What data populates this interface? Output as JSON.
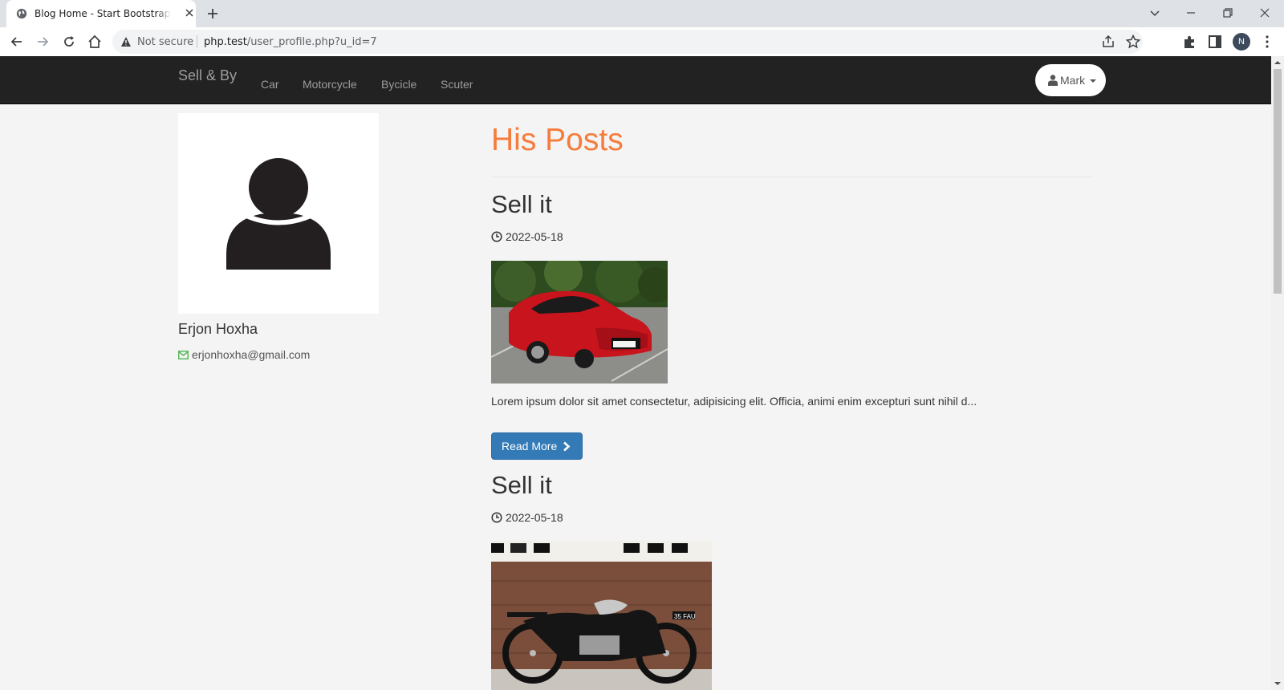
{
  "browser": {
    "tab_title": "Blog Home - Start Bootstrap Template",
    "security_label": "Not secure",
    "url_host": "php.test",
    "url_path": "/user_profile.php?u_id=7",
    "profile_initial": "N"
  },
  "navbar": {
    "brand": "Sell & By",
    "links": [
      "Car",
      "Motorcycle",
      "Bycicle",
      "Scuter"
    ],
    "user_menu_label": "Mark"
  },
  "profile": {
    "name": "Erjon Hoxha",
    "email": "erjonhoxha@gmail.com"
  },
  "posts_heading": "His Posts",
  "posts": [
    {
      "title": "Sell it",
      "date": "2022-05-18",
      "image": "red-hatchback-car-photo",
      "excerpt": "Lorem ipsum dolor sit amet consectetur, adipisicing elit. Officia, animi enim excepturi sunt nihil d...",
      "button_label": "Read More"
    },
    {
      "title": "Sell it",
      "date": "2022-05-18",
      "image": "classic-motorcycle-photo",
      "plate": "35 FAU"
    }
  ],
  "colors": {
    "navbar_bg": "#222222",
    "heading_accent": "#f57c3b",
    "button_primary": "#337ab7",
    "mail_icon": "#5cb85c"
  }
}
